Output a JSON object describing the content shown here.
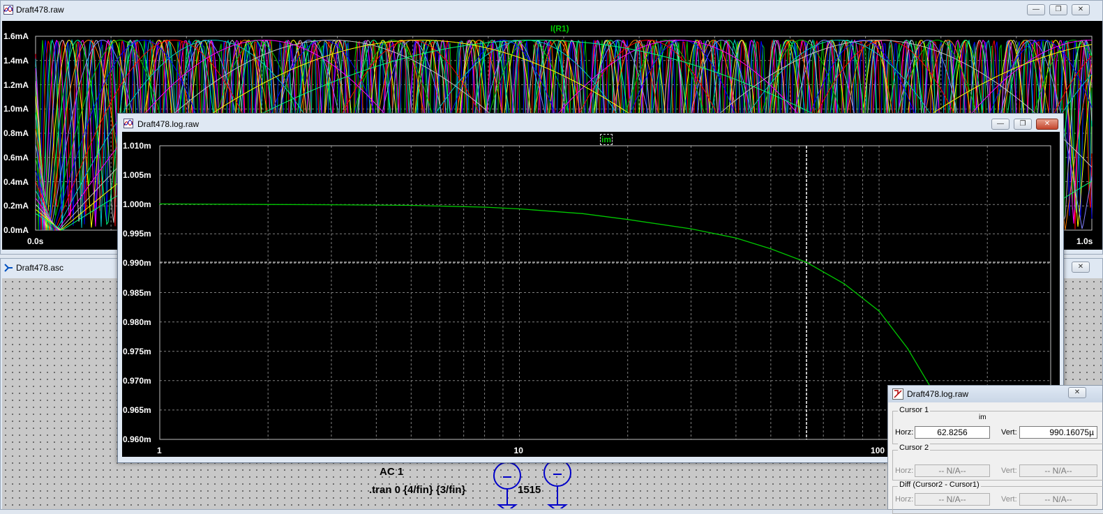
{
  "top_window": {
    "title": "Draft478.raw",
    "trace_label": "I(R1)",
    "y_ticks": [
      "1.6mA",
      "1.4mA",
      "1.2mA",
      "1.0mA",
      "0.8mA",
      "0.6mA",
      "0.4mA",
      "0.2mA",
      "0.0mA"
    ],
    "x_start": "0.0s",
    "x_end": "1.0s"
  },
  "schematic_window": {
    "title": "Draft478.asc",
    "texts": {
      "ac": "AC 1",
      "tran": ".tran 0 {4/fin} {3/fin}",
      "num": "1515"
    }
  },
  "log_window": {
    "title": "Draft478.log.raw",
    "trace_label": "im",
    "y_ticks": [
      "1.010m",
      "1.005m",
      "1.000m",
      "0.995m",
      "0.990m",
      "0.985m",
      "0.980m",
      "0.975m",
      "0.970m",
      "0.965m",
      "0.960m"
    ],
    "x_ticks": [
      "1",
      "10",
      "100"
    ]
  },
  "cursor_panel": {
    "title": "Draft478.log.raw",
    "cursor1_label": "Cursor 1",
    "trace": "im",
    "horz_label": "Horz:",
    "vert_label": "Vert:",
    "horz_value": "62.8256",
    "vert_value": "990.16075µ",
    "cursor2_label": "Cursor 2",
    "na": "-- N/A--",
    "diff_label": "Diff (Cursor2 - Cursor1)"
  },
  "chart_data": {
    "type": "line",
    "title": "im",
    "xlabel": "",
    "ylabel": "",
    "x_scale": "log",
    "xlim": [
      1,
      300
    ],
    "ylim": [
      0.96,
      1.01
    ],
    "grid": true,
    "series": [
      {
        "name": "im",
        "color": "#00c800",
        "x": [
          1,
          2,
          3,
          5,
          8,
          10,
          15,
          20,
          30,
          40,
          50,
          62.83,
          80,
          100,
          120,
          150,
          170
        ],
        "y": [
          1.0001,
          1.0,
          0.99995,
          0.99985,
          0.99955,
          0.99925,
          0.99845,
          0.99745,
          0.99585,
          0.9943,
          0.99245,
          0.99016,
          0.9865,
          0.98185,
          0.9755,
          0.9655,
          0.96
        ]
      }
    ],
    "cursor": {
      "x": 62.8256,
      "y": 0.99016
    }
  },
  "colors": {
    "trace_green": "#00c800",
    "plot_background": "#000000",
    "grid": "#808080"
  }
}
